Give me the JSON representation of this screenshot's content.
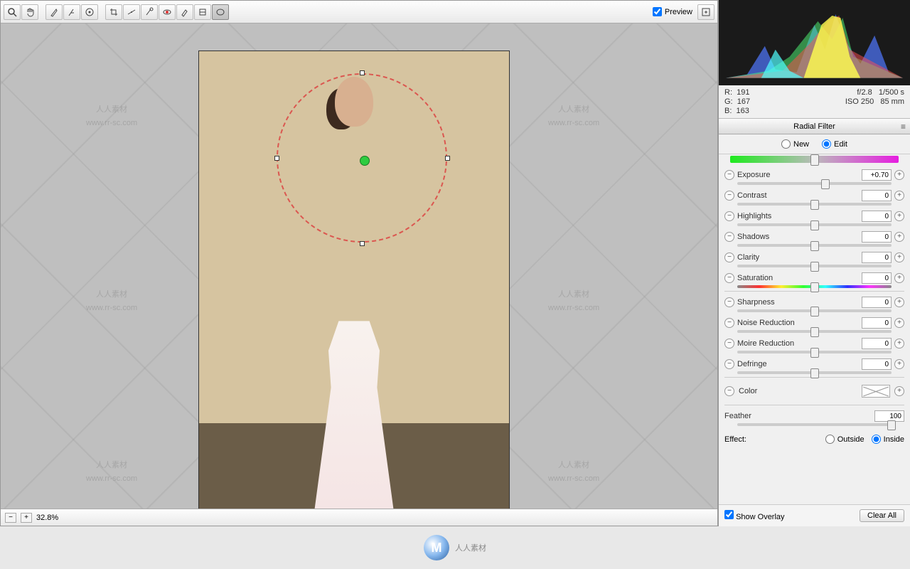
{
  "toolbar": {
    "preview_label": "Preview",
    "preview_checked": true
  },
  "status": {
    "zoom": "32.8%"
  },
  "readout": {
    "r_label": "R:",
    "r": "191",
    "g_label": "G:",
    "g": "167",
    "b_label": "B:",
    "b": "163",
    "aperture": "f/2.8",
    "shutter": "1/500 s",
    "iso": "ISO 250",
    "focal": "85 mm"
  },
  "panel": {
    "title": "Radial Filter",
    "mode": {
      "new_label": "New",
      "edit_label": "Edit",
      "selected": "Edit"
    },
    "sliders": [
      {
        "label": "Exposure",
        "value": "+0.70",
        "pos": 57
      },
      {
        "label": "Contrast",
        "value": "0",
        "pos": 50
      },
      {
        "label": "Highlights",
        "value": "0",
        "pos": 50
      },
      {
        "label": "Shadows",
        "value": "0",
        "pos": 50
      },
      {
        "label": "Clarity",
        "value": "0",
        "pos": 50
      },
      {
        "label": "Saturation",
        "value": "0",
        "pos": 50,
        "gradient": true
      }
    ],
    "sliders2": [
      {
        "label": "Sharpness",
        "value": "0",
        "pos": 50
      },
      {
        "label": "Noise Reduction",
        "value": "0",
        "pos": 50
      },
      {
        "label": "Moire Reduction",
        "value": "0",
        "pos": 50
      },
      {
        "label": "Defringe",
        "value": "0",
        "pos": 50
      }
    ],
    "color_label": "Color",
    "feather": {
      "label": "Feather",
      "value": "100",
      "pos": 100
    },
    "effect": {
      "label": "Effect:",
      "outside": "Outside",
      "inside": "Inside",
      "selected": "Inside"
    },
    "show_overlay": "Show Overlay",
    "clear_all": "Clear All"
  },
  "watermark": {
    "line1": "人人素材",
    "line2": "www.rr-sc.com"
  },
  "footer": {
    "logo": "M",
    "text": "人人素材"
  }
}
